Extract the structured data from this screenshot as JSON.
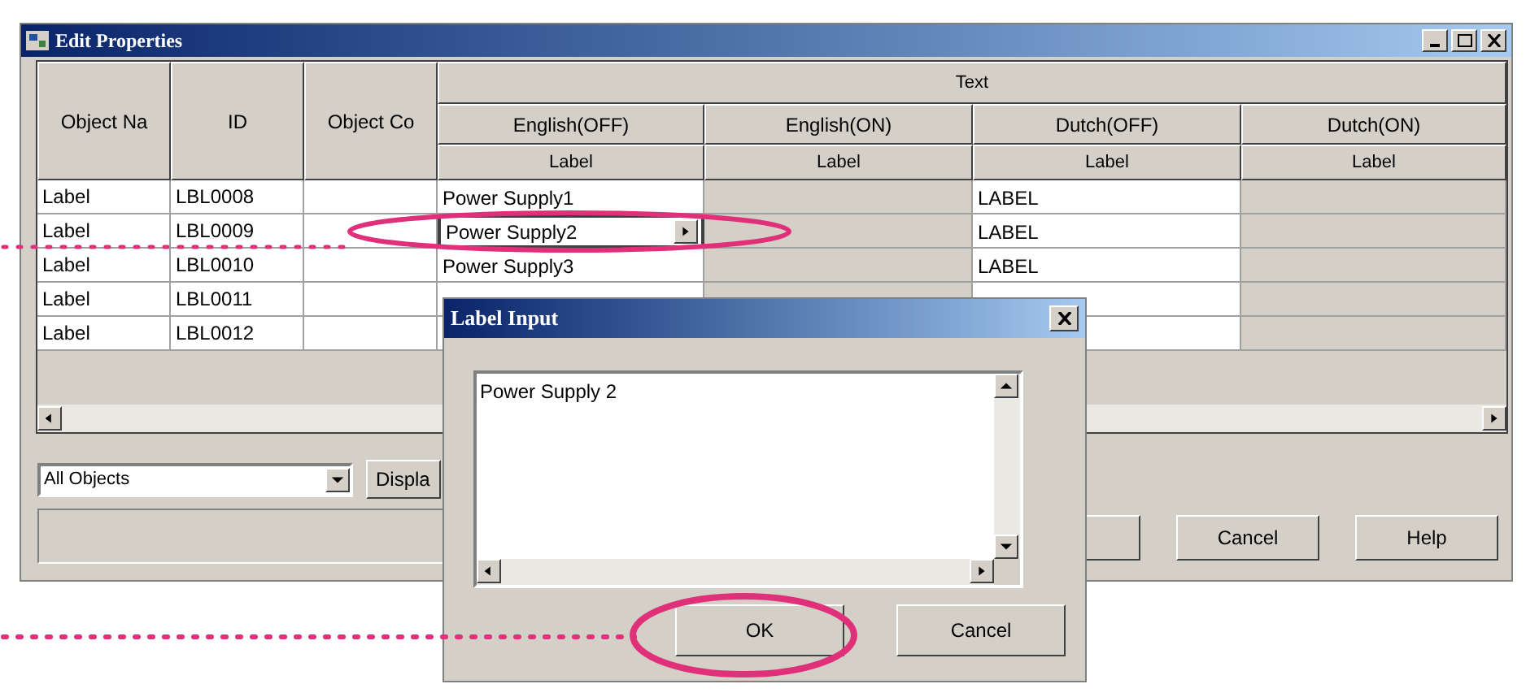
{
  "window": {
    "title": "Edit Properties"
  },
  "table": {
    "group_heading": "Text",
    "columns": [
      "Object Na",
      "ID",
      "Object Co"
    ],
    "text_columns": [
      {
        "label": "English(OFF)",
        "sub_label": "Label",
        "editable": true
      },
      {
        "label": "English(ON)",
        "sub_label": "Label",
        "editable": false
      },
      {
        "label": "Dutch(OFF)",
        "sub_label": "Label",
        "editable": true
      },
      {
        "label": "Dutch(ON)",
        "sub_label": "Label",
        "editable": false
      }
    ],
    "rows": [
      {
        "object_name": "Label",
        "id": "LBL0008",
        "english_off": "Power Supply1",
        "dutch_off": "LABEL"
      },
      {
        "object_name": "Label",
        "id": "LBL0009",
        "english_off_editor": "Power Supply2",
        "dutch_off": "LABEL"
      },
      {
        "object_name": "Label",
        "id": "LBL0010",
        "english_off": "Power Supply3",
        "dutch_off": "LABEL"
      },
      {
        "object_name": "Label",
        "id": "LBL0011"
      },
      {
        "object_name": "Label",
        "id": "LBL0012"
      }
    ]
  },
  "filter": {
    "value": "All Objects"
  },
  "display_button": "Displa",
  "buttons": [
    "Cancel",
    "Help"
  ],
  "dialog": {
    "title": "Label Input",
    "value": "Power Supply 2",
    "buttons": [
      "OK",
      "Cancel"
    ]
  }
}
